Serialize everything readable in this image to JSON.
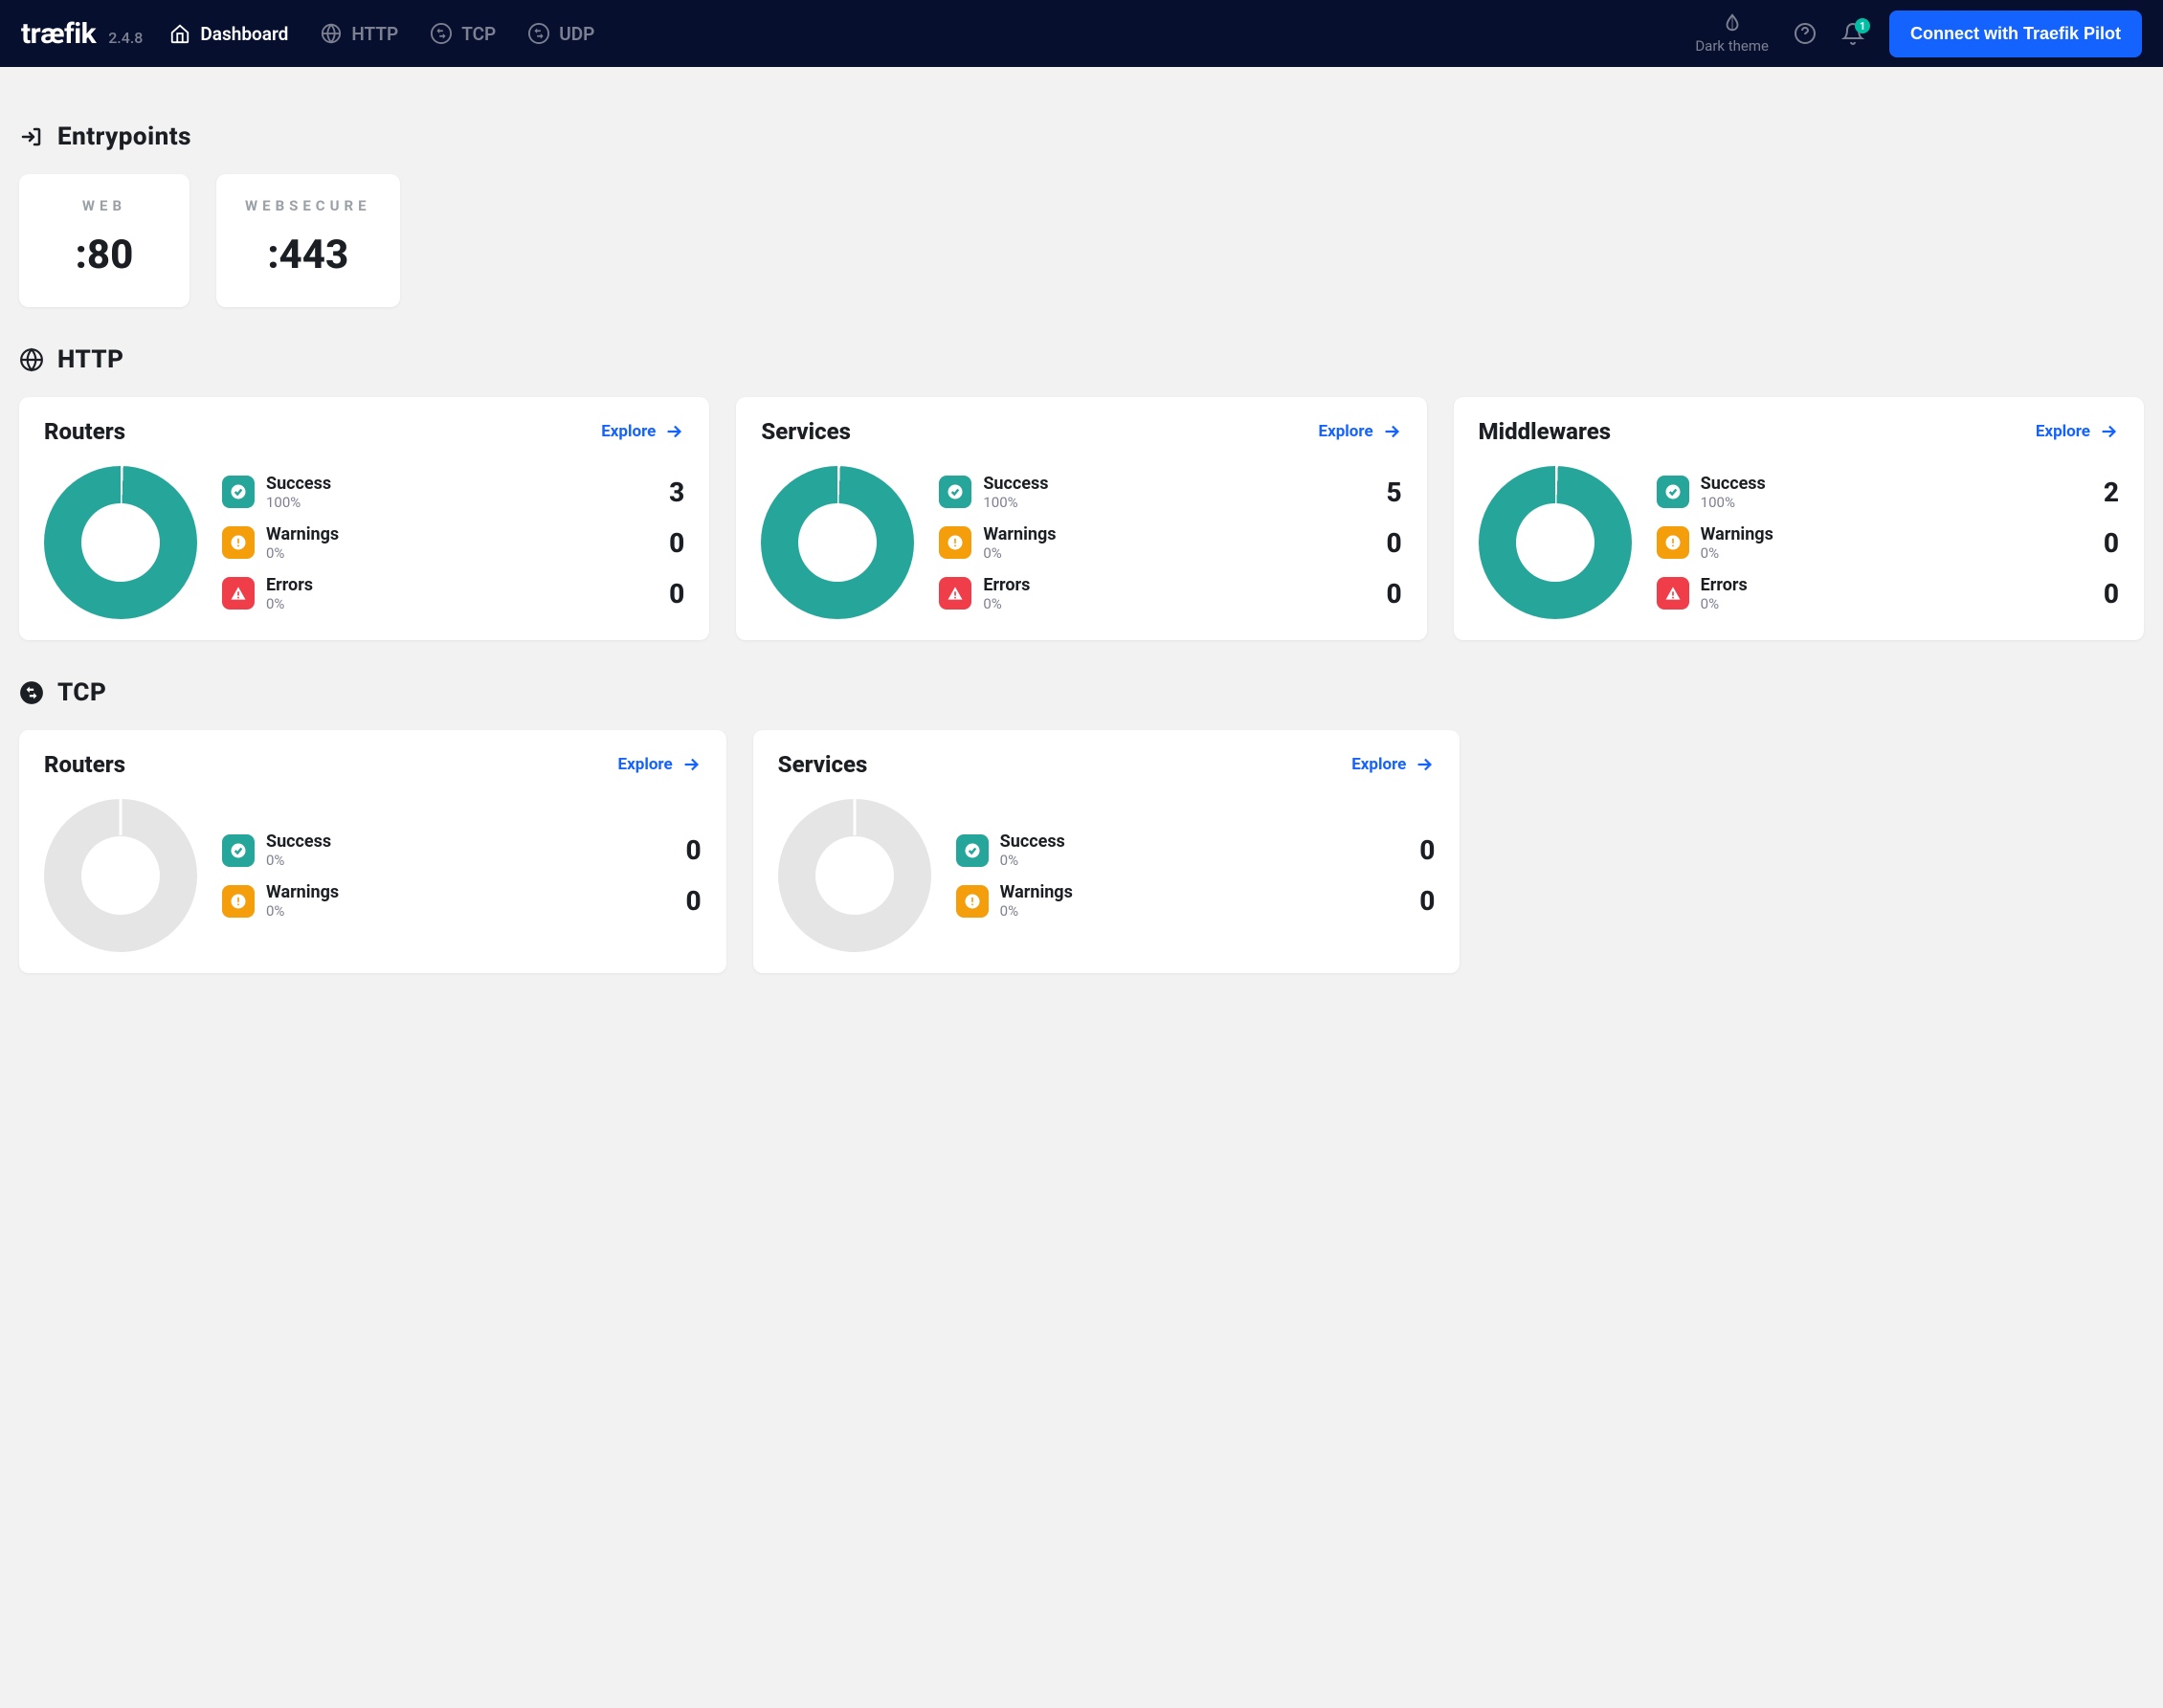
{
  "header": {
    "logo": "træfik",
    "version": "2.4.8",
    "nav": {
      "dashboard": "Dashboard",
      "http": "HTTP",
      "tcp": "TCP",
      "udp": "UDP"
    },
    "dark_theme": "Dark theme",
    "notification_badge": "1",
    "pilot_button": "Connect with Traefik Pilot"
  },
  "sections": {
    "entrypoints": {
      "title": "Entrypoints",
      "items": [
        {
          "name": "WEB",
          "port": ":80"
        },
        {
          "name": "WEBSECURE",
          "port": ":443"
        }
      ]
    },
    "http": {
      "title": "HTTP",
      "cards": [
        {
          "title": "Routers",
          "explore": "Explore",
          "success_pct": "100%",
          "success_count": "3",
          "warn_pct": "0%",
          "warn_count": "0",
          "err_pct": "0%",
          "err_count": "0"
        },
        {
          "title": "Services",
          "explore": "Explore",
          "success_pct": "100%",
          "success_count": "5",
          "warn_pct": "0%",
          "warn_count": "0",
          "err_pct": "0%",
          "err_count": "0"
        },
        {
          "title": "Middlewares",
          "explore": "Explore",
          "success_pct": "100%",
          "success_count": "2",
          "warn_pct": "0%",
          "warn_count": "0",
          "err_pct": "0%",
          "err_count": "0"
        }
      ]
    },
    "tcp": {
      "title": "TCP",
      "cards": [
        {
          "title": "Routers",
          "explore": "Explore",
          "success_pct": "0%",
          "success_count": "0",
          "warn_pct": "0%",
          "warn_count": "0"
        },
        {
          "title": "Services",
          "explore": "Explore",
          "success_pct": "0%",
          "success_count": "0",
          "warn_pct": "0%",
          "warn_count": "0"
        }
      ]
    }
  },
  "labels": {
    "success": "Success",
    "warnings": "Warnings",
    "errors": "Errors"
  },
  "chart_data": [
    {
      "type": "pie",
      "title": "HTTP Routers",
      "series": [
        {
          "name": "Success",
          "value": 3
        },
        {
          "name": "Warnings",
          "value": 0
        },
        {
          "name": "Errors",
          "value": 0
        }
      ]
    },
    {
      "type": "pie",
      "title": "HTTP Services",
      "series": [
        {
          "name": "Success",
          "value": 5
        },
        {
          "name": "Warnings",
          "value": 0
        },
        {
          "name": "Errors",
          "value": 0
        }
      ]
    },
    {
      "type": "pie",
      "title": "HTTP Middlewares",
      "series": [
        {
          "name": "Success",
          "value": 2
        },
        {
          "name": "Warnings",
          "value": 0
        },
        {
          "name": "Errors",
          "value": 0
        }
      ]
    },
    {
      "type": "pie",
      "title": "TCP Routers",
      "series": [
        {
          "name": "Success",
          "value": 0
        },
        {
          "name": "Warnings",
          "value": 0
        }
      ]
    },
    {
      "type": "pie",
      "title": "TCP Services",
      "series": [
        {
          "name": "Success",
          "value": 0
        },
        {
          "name": "Warnings",
          "value": 0
        }
      ]
    }
  ]
}
